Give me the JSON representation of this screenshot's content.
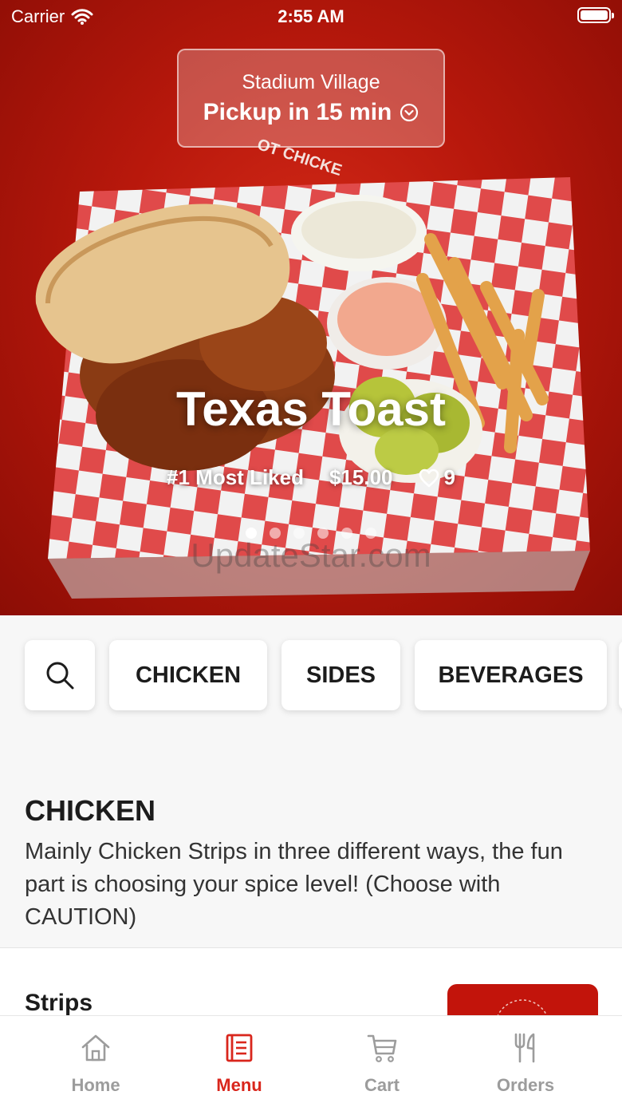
{
  "status_bar": {
    "carrier": "Carrier",
    "time": "2:55 AM"
  },
  "location": {
    "name": "Stadium Village",
    "pickup": "Pickup in 15 min"
  },
  "featured": {
    "title": "Texas Toast",
    "badge": "#1 Most Liked",
    "price": "$15.00",
    "likes": "9",
    "slides_total": 6,
    "slide_active": 1
  },
  "watermark": "UpdateStar.com",
  "categories": [
    "CHICKEN",
    "SIDES",
    "BEVERAGES"
  ],
  "section": {
    "title": "CHICKEN",
    "description": "Mainly Chicken Strips in three different ways, the fun part is choosing your spice level! (Choose with CAUTION)"
  },
  "items": [
    {
      "title": "Strips"
    }
  ],
  "tabs": [
    {
      "label": "Home",
      "icon": "home-icon"
    },
    {
      "label": "Menu",
      "icon": "menu-icon",
      "active": true
    },
    {
      "label": "Cart",
      "icon": "cart-icon"
    },
    {
      "label": "Orders",
      "icon": "fork-knife-icon"
    }
  ],
  "colors": {
    "brand_red": "#d9261c",
    "hero_red": "#b8180c",
    "inactive": "#9c9c9c"
  }
}
